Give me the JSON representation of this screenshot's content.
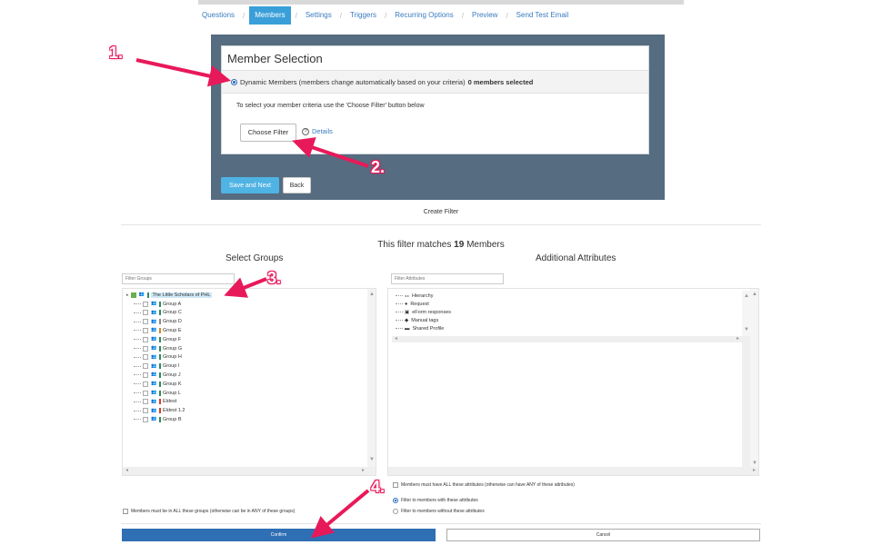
{
  "nav": {
    "tabs": [
      "Questions",
      "Members",
      "Settings",
      "Triggers",
      "Recurring Options",
      "Preview",
      "Send Test Email"
    ],
    "active_index": 1
  },
  "member_selection": {
    "title": "Member Selection",
    "radio_label": "Dynamic Members (members change automatically based on your criteria)",
    "selected_count": "0 members selected",
    "help_text": "To select your member criteria use the 'Choose Filter' button below",
    "choose_filter_label": "Choose Filter",
    "details_label": "Details",
    "save_next_label": "Save and Next",
    "back_label": "Back"
  },
  "filter": {
    "create_filter_label": "Create Filter",
    "matches_prefix": "This filter matches",
    "matches_count": "19",
    "matches_suffix": "Members",
    "select_groups_title": "Select Groups",
    "additional_attributes_title": "Additional Attributes",
    "filter_groups_placeholder": "Filter Groups",
    "filter_attributes_placeholder": "Filter Attributes",
    "root_group": "The Little Scholars of PHL",
    "groups": [
      {
        "label": "Group A",
        "tag_color": "#2e8b57"
      },
      {
        "label": "Group C",
        "tag_color": "#2e8b57"
      },
      {
        "label": "Group D",
        "tag_color": "#8a8a8a"
      },
      {
        "label": "Group E",
        "tag_color": "#d08a2a"
      },
      {
        "label": "Group F",
        "tag_color": "#2e8b57"
      },
      {
        "label": "Group G",
        "tag_color": "#2e8b57"
      },
      {
        "label": "Group H",
        "tag_color": "#2e8b57"
      },
      {
        "label": "Group I",
        "tag_color": "#2e8b57"
      },
      {
        "label": "Group J",
        "tag_color": "#2e8b57"
      },
      {
        "label": "Group K",
        "tag_color": "#2e8b57"
      },
      {
        "label": "Group L",
        "tag_color": "#2e8b57"
      },
      {
        "label": "Eldest",
        "tag_color": "#d0402a"
      },
      {
        "label": "Eldest 1.2",
        "tag_color": "#d0402a"
      },
      {
        "label": "Group B",
        "tag_color": "#2e8b57"
      }
    ],
    "attributes": [
      {
        "label": "Hierarchy",
        "icon": "hierarchy-icon"
      },
      {
        "label": "Request",
        "icon": "person-icon"
      },
      {
        "label": "eForm responses",
        "icon": "form-icon"
      },
      {
        "label": "Manual tags",
        "icon": "tag-icon"
      },
      {
        "label": "Shared Profile",
        "icon": "card-icon"
      }
    ],
    "all_groups_label": "Members must be in ALL these groups (otherwise can be in ANY of these groups)",
    "all_attributes_label": "Members must have ALL these attributes (otherwise can have ANY of these attributes)",
    "with_attributes_label": "Filter to members with these attributes",
    "without_attributes_label": "Filter to members without these attributes",
    "confirm_label": "Confirm",
    "cancel_label": "Cancel"
  },
  "annotations": {
    "step1": "1.",
    "step2": "2.",
    "step3": "3.",
    "step4": "4.",
    "color": "#e8195a"
  }
}
